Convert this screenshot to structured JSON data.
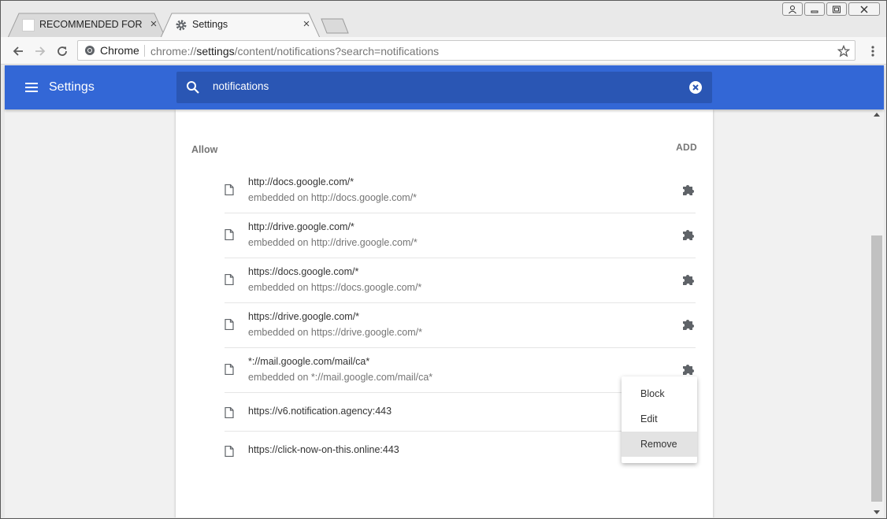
{
  "tabs": [
    {
      "title": "RECOMMENDED FOR YO",
      "active": false
    },
    {
      "title": "Settings",
      "active": true
    }
  ],
  "toolbar": {
    "chip_label": "Chrome",
    "url_scheme": "chrome://",
    "url_host": "settings",
    "url_rest": "/content/notifications?search=notifications"
  },
  "header": {
    "title": "Settings",
    "search_value": "notifications"
  },
  "section": {
    "label": "Allow",
    "add_label": "ADD"
  },
  "sites": [
    {
      "site": "http://docs.google.com/*",
      "embedded": "embedded on http://docs.google.com/*"
    },
    {
      "site": "http://drive.google.com/*",
      "embedded": "embedded on http://drive.google.com/*"
    },
    {
      "site": "https://docs.google.com/*",
      "embedded": "embedded on https://docs.google.com/*"
    },
    {
      "site": "https://drive.google.com/*",
      "embedded": "embedded on https://drive.google.com/*"
    },
    {
      "site": "*://mail.google.com/mail/ca*",
      "embedded": "embedded on *://mail.google.com/mail/ca*"
    },
    {
      "site": "https://v6.notification.agency:443",
      "embedded": ""
    },
    {
      "site": "https://click-now-on-this.online:443",
      "embedded": ""
    }
  ],
  "context_menu": {
    "items": [
      "Block",
      "Edit",
      "Remove"
    ],
    "highlighted": "Remove"
  },
  "colors": {
    "header_blue": "#3367d6",
    "search_blue": "#2a56b4",
    "icon_gray": "#5f6368"
  },
  "icons": {
    "menu": "hamburger-menu-icon",
    "search": "search-icon",
    "clear": "clear-search-icon",
    "extension": "puzzle-extension-icon",
    "document": "document-icon"
  }
}
